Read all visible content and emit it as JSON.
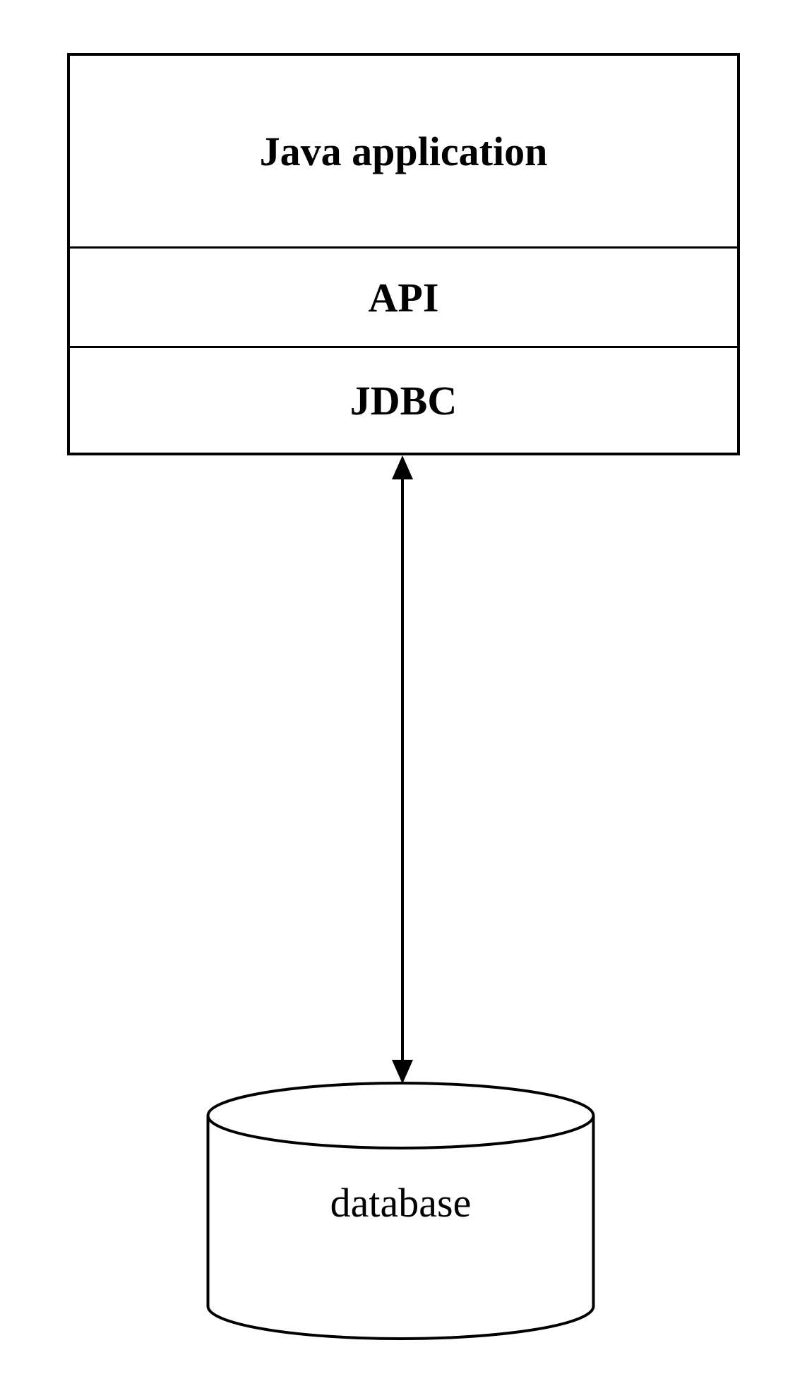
{
  "layers": {
    "app": "Java application",
    "api": "API",
    "jdbc": "JDBC"
  },
  "database": {
    "label": "database"
  }
}
